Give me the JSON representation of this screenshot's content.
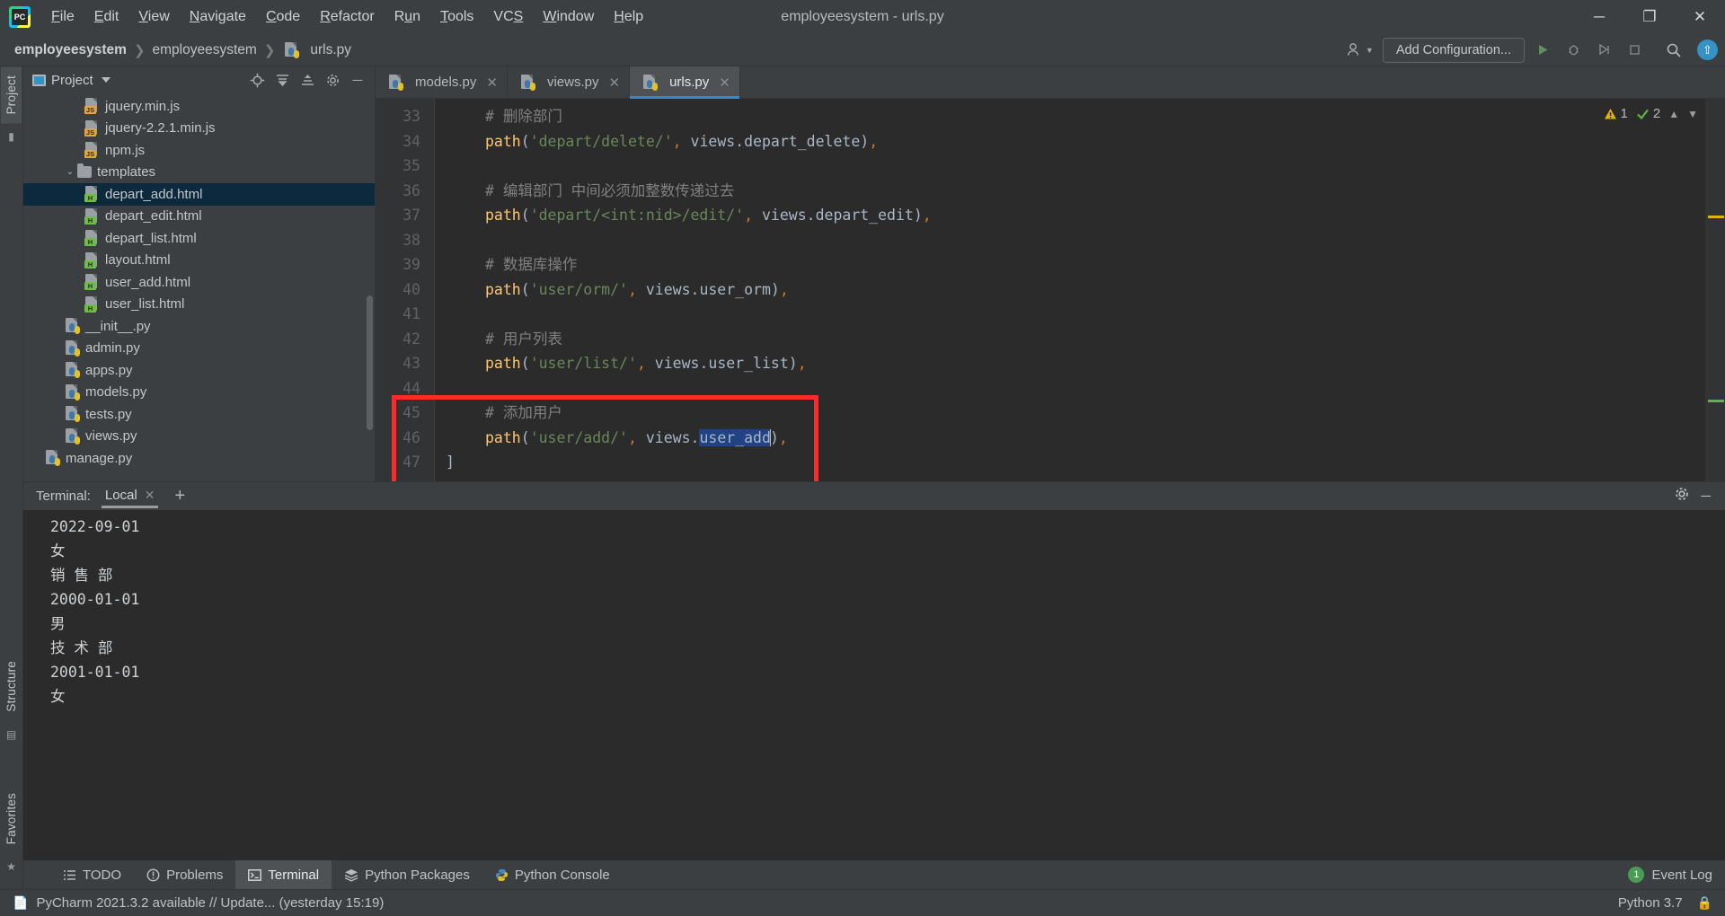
{
  "window": {
    "title": "employeesystem - urls.py",
    "logo_text": "PC",
    "controls": {
      "minimize": "─",
      "maximize": "❐",
      "close": "✕"
    }
  },
  "menu": [
    {
      "label": "File",
      "mnemonic": "F"
    },
    {
      "label": "Edit",
      "mnemonic": "E"
    },
    {
      "label": "View",
      "mnemonic": "V"
    },
    {
      "label": "Navigate",
      "mnemonic": "N"
    },
    {
      "label": "Code",
      "mnemonic": "C"
    },
    {
      "label": "Refactor",
      "mnemonic": "R"
    },
    {
      "label": "Run",
      "mnemonic": "u"
    },
    {
      "label": "Tools",
      "mnemonic": "T"
    },
    {
      "label": "VCS",
      "mnemonic": "S"
    },
    {
      "label": "Window",
      "mnemonic": "W"
    },
    {
      "label": "Help",
      "mnemonic": "H"
    }
  ],
  "navbar": {
    "breadcrumbs": [
      "employeesystem",
      "employeesystem",
      "urls.py"
    ],
    "separator": "❯",
    "add_configuration": "Add Configuration...",
    "icons": {
      "user": "user-icon",
      "run": "run-icon",
      "debug": "debug-icon",
      "coverage": "coverage-icon",
      "stop": "stop-icon",
      "search": "search-icon",
      "update": "update-icon"
    }
  },
  "left_strip": {
    "project_tab": "Project",
    "structure_tab": "Structure",
    "favorites_tab": "Favorites"
  },
  "project_panel": {
    "title": "Project",
    "tools": [
      "locate-icon",
      "collapse-all-icon",
      "expand-all-icon",
      "settings-icon",
      "hide-icon"
    ],
    "tree": [
      {
        "label": "jquery.min.js",
        "type": "js",
        "indent": 3,
        "selected": false
      },
      {
        "label": "jquery-2.2.1.min.js",
        "type": "js",
        "indent": 3,
        "selected": false
      },
      {
        "label": "npm.js",
        "type": "js",
        "indent": 3,
        "selected": false
      },
      {
        "label": "templates",
        "type": "folder",
        "indent": 2,
        "selected": false,
        "expanded": true
      },
      {
        "label": "depart_add.html",
        "type": "html",
        "indent": 3,
        "selected": true
      },
      {
        "label": "depart_edit.html",
        "type": "html",
        "indent": 3,
        "selected": false
      },
      {
        "label": "depart_list.html",
        "type": "html",
        "indent": 3,
        "selected": false
      },
      {
        "label": "layout.html",
        "type": "html",
        "indent": 3,
        "selected": false
      },
      {
        "label": "user_add.html",
        "type": "html",
        "indent": 3,
        "selected": false
      },
      {
        "label": "user_list.html",
        "type": "html",
        "indent": 3,
        "selected": false
      },
      {
        "label": "__init__.py",
        "type": "py",
        "indent": 2,
        "selected": false
      },
      {
        "label": "admin.py",
        "type": "py",
        "indent": 2,
        "selected": false
      },
      {
        "label": "apps.py",
        "type": "py",
        "indent": 2,
        "selected": false
      },
      {
        "label": "models.py",
        "type": "py",
        "indent": 2,
        "selected": false
      },
      {
        "label": "tests.py",
        "type": "py",
        "indent": 2,
        "selected": false
      },
      {
        "label": "views.py",
        "type": "py",
        "indent": 2,
        "selected": false
      },
      {
        "label": "manage.py",
        "type": "py",
        "indent": 1,
        "selected": false
      }
    ]
  },
  "editor": {
    "tabs": [
      {
        "label": "models.py",
        "active": false
      },
      {
        "label": "views.py",
        "active": false
      },
      {
        "label": "urls.py",
        "active": true
      }
    ],
    "inspection": {
      "warnings": "1",
      "oks": "2"
    },
    "first_line_number": 33,
    "lines": [
      {
        "n": "33",
        "segments": [
          {
            "t": "# 删除部门",
            "c": "cmt"
          }
        ]
      },
      {
        "n": "34",
        "segments": [
          {
            "t": "path",
            "c": "fn"
          },
          {
            "t": "(",
            "c": "pun"
          },
          {
            "t": "'depart/delete/'",
            "c": "str"
          },
          {
            "t": ",",
            "c": "comma"
          },
          {
            "t": " views.depart_delete",
            "c": "pun"
          },
          {
            "t": ")",
            "c": "pun"
          },
          {
            "t": ",",
            "c": "comma"
          }
        ]
      },
      {
        "n": "35",
        "segments": []
      },
      {
        "n": "36",
        "segments": [
          {
            "t": "# 编辑部门 中间必须加整数传递过去",
            "c": "cmt"
          }
        ]
      },
      {
        "n": "37",
        "segments": [
          {
            "t": "path",
            "c": "fn"
          },
          {
            "t": "(",
            "c": "pun"
          },
          {
            "t": "'depart/<int:nid>/edit/'",
            "c": "str"
          },
          {
            "t": ",",
            "c": "comma"
          },
          {
            "t": " views.depart_edit",
            "c": "pun"
          },
          {
            "t": ")",
            "c": "pun"
          },
          {
            "t": ",",
            "c": "comma"
          }
        ]
      },
      {
        "n": "38",
        "segments": []
      },
      {
        "n": "39",
        "segments": [
          {
            "t": "# 数据库操作",
            "c": "cmt"
          }
        ]
      },
      {
        "n": "40",
        "segments": [
          {
            "t": "path",
            "c": "fn"
          },
          {
            "t": "(",
            "c": "pun"
          },
          {
            "t": "'user/orm/'",
            "c": "str"
          },
          {
            "t": ",",
            "c": "comma"
          },
          {
            "t": " views.user_orm",
            "c": "pun"
          },
          {
            "t": ")",
            "c": "pun"
          },
          {
            "t": ",",
            "c": "comma"
          }
        ]
      },
      {
        "n": "41",
        "segments": []
      },
      {
        "n": "42",
        "segments": [
          {
            "t": "# 用户列表",
            "c": "cmt"
          }
        ]
      },
      {
        "n": "43",
        "segments": [
          {
            "t": "path",
            "c": "fn"
          },
          {
            "t": "(",
            "c": "pun"
          },
          {
            "t": "'user/list/'",
            "c": "str"
          },
          {
            "t": ",",
            "c": "comma"
          },
          {
            "t": " views.user_list",
            "c": "pun"
          },
          {
            "t": ")",
            "c": "pun"
          },
          {
            "t": ",",
            "c": "comma"
          }
        ]
      },
      {
        "n": "44",
        "segments": []
      },
      {
        "n": "45",
        "segments": [
          {
            "t": "# 添加用户",
            "c": "cmt"
          }
        ]
      },
      {
        "n": "46",
        "segments": [
          {
            "t": "path",
            "c": "fn"
          },
          {
            "t": "(",
            "c": "pun"
          },
          {
            "t": "'user/add/'",
            "c": "str"
          },
          {
            "t": ",",
            "c": "comma"
          },
          {
            "t": " views.",
            "c": "pun"
          },
          {
            "t": "user_add",
            "c": "sel-tok"
          },
          {
            "t": ")",
            "c": "pun"
          },
          {
            "t": ",",
            "c": "comma"
          }
        ]
      },
      {
        "n": "47",
        "segments": [
          {
            "t": "]",
            "c": "pun"
          }
        ],
        "noindent": true
      }
    ]
  },
  "terminal": {
    "label": "Terminal:",
    "tab": "Local",
    "close": "✕",
    "add": "+",
    "output": [
      "2022-09-01",
      "女",
      "销 售 部",
      "2000-01-01",
      "男",
      "技 术 部",
      "2001-01-01",
      "女"
    ]
  },
  "bottom_toolbar": {
    "items": [
      {
        "label": "TODO",
        "icon": "todo-icon",
        "active": false
      },
      {
        "label": "Problems",
        "icon": "problems-icon",
        "active": false
      },
      {
        "label": "Terminal",
        "icon": "terminal-icon",
        "active": true
      },
      {
        "label": "Python Packages",
        "icon": "packages-icon",
        "active": false
      },
      {
        "label": "Python Console",
        "icon": "python-console-icon",
        "active": false
      }
    ],
    "event_log": {
      "label": "Event Log",
      "count": "1"
    }
  },
  "statusbar": {
    "message": "PyCharm 2021.3.2 available // Update... (yesterday 15:19)",
    "interpreter": "Python 3.7",
    "icons": [
      "notification-icon",
      "lock-icon"
    ]
  }
}
